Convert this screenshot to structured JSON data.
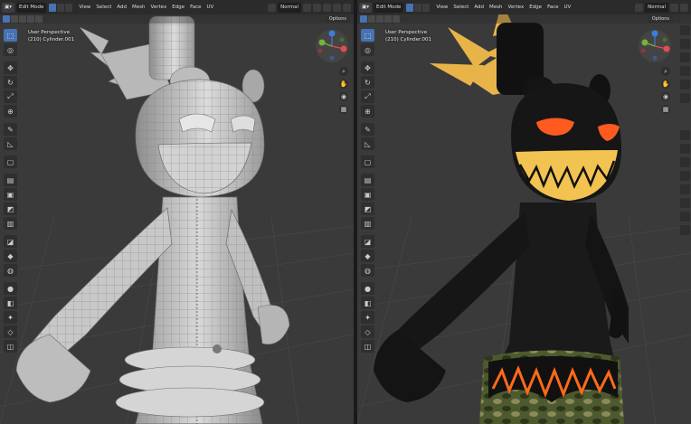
{
  "viewports": [
    {
      "mode": "Edit Mode",
      "menus": [
        "View",
        "Select",
        "Add",
        "Mesh",
        "Vertex",
        "Edge",
        "Face",
        "UV"
      ],
      "orientation": "Normal",
      "options_label": "Options",
      "perspective": "User Perspective",
      "object": "(210) Cylinder.001"
    },
    {
      "mode": "Edit Mode",
      "menus": [
        "View",
        "Select",
        "Add",
        "Mesh",
        "Vertex",
        "Edge",
        "Face",
        "UV"
      ],
      "orientation": "Normal",
      "options_label": "Options",
      "perspective": "User Perspective",
      "object": "(210) Cylinder.001"
    }
  ],
  "icons": {
    "tools": [
      "select-box-icon",
      "cursor-icon",
      "move-icon",
      "rotate-icon",
      "scale-icon",
      "transform-icon",
      "annotate-icon",
      "measure-icon",
      "add-cube-icon",
      "extrude-icon",
      "inset-icon",
      "bevel-icon",
      "loop-cut-icon",
      "knife-icon",
      "poly-build-icon",
      "spin-icon",
      "smooth-icon",
      "edge-slide-icon",
      "shrink-fatten-icon",
      "shear-icon",
      "rip-icon"
    ],
    "nav": [
      "zoom-icon",
      "hand-pan-icon",
      "camera-icon",
      "grid-icon"
    ]
  },
  "colors": {
    "header_bg": "#2b2b2b",
    "active_blue": "#4772b3",
    "axis_x": "#e44d4d",
    "axis_y": "#74b336",
    "axis_z": "#3b7dd8",
    "crown_yellow": "#e8b44a",
    "eye_orange": "#ff5a20",
    "teeth_yellow": "#f2c350",
    "flame": "#ff6a1a"
  }
}
